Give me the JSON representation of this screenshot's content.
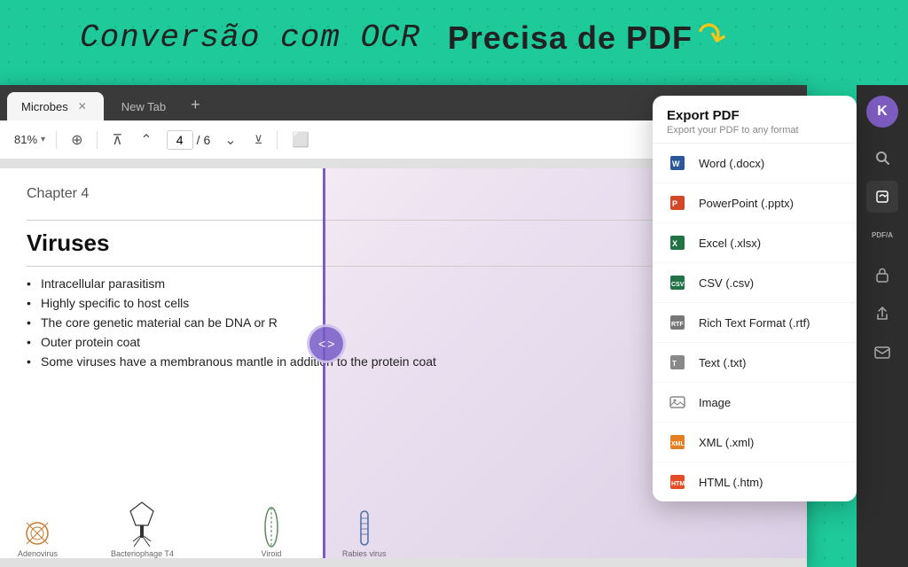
{
  "header": {
    "title": "Conversão com OCR Precisa de PDF",
    "title_part1": "Conversão com OCR",
    "title_part2": "Precisa de PDF"
  },
  "tabs": [
    {
      "label": "Microbes",
      "active": true
    },
    {
      "label": "New Tab",
      "active": false
    }
  ],
  "tab_add": "+",
  "toolbar": {
    "zoom": "81%",
    "zoom_chevron": "▾",
    "page_current": "4",
    "page_separator": "/",
    "page_total": "6"
  },
  "pdf": {
    "chapter": "Chapter 4",
    "section_title": "Viruses",
    "bullets": [
      "Intracellular parasitism",
      "Highly specific to host cells",
      "The core genetic material can be DNA or R",
      "Outer protein coat",
      "Some viruses have a membranous mantle in addition to the protein coat"
    ],
    "illustrations": [
      {
        "label": "Adenovirus"
      },
      {
        "label": "Bacteriophage T4"
      },
      {
        "label": "Viroid"
      },
      {
        "label": "Rabies virus"
      }
    ]
  },
  "sidebar": {
    "avatar_letter": "K",
    "icons": [
      {
        "name": "search",
        "symbol": "🔍"
      },
      {
        "name": "convert",
        "symbol": "⟳"
      },
      {
        "name": "pdf-a",
        "symbol": "PDF/A"
      },
      {
        "name": "lock",
        "symbol": "🔒"
      },
      {
        "name": "share",
        "symbol": "↑"
      },
      {
        "name": "mail",
        "symbol": "✉"
      }
    ]
  },
  "export_panel": {
    "title": "Export PDF",
    "subtitle": "Export your PDF to any format",
    "items": [
      {
        "label": "Word (.docx)",
        "icon_type": "word"
      },
      {
        "label": "PowerPoint (.pptx)",
        "icon_type": "ppt"
      },
      {
        "label": "Excel (.xlsx)",
        "icon_type": "excel"
      },
      {
        "label": "CSV (.csv)",
        "icon_type": "csv"
      },
      {
        "label": "Rich Text Format (.rtf)",
        "icon_type": "rtf"
      },
      {
        "label": "Text (.txt)",
        "icon_type": "txt"
      },
      {
        "label": "Image",
        "icon_type": "image"
      },
      {
        "label": "XML (.xml)",
        "icon_type": "xml"
      },
      {
        "label": "HTML (.htm)",
        "icon_type": "html"
      }
    ]
  },
  "expand_button": "< >"
}
